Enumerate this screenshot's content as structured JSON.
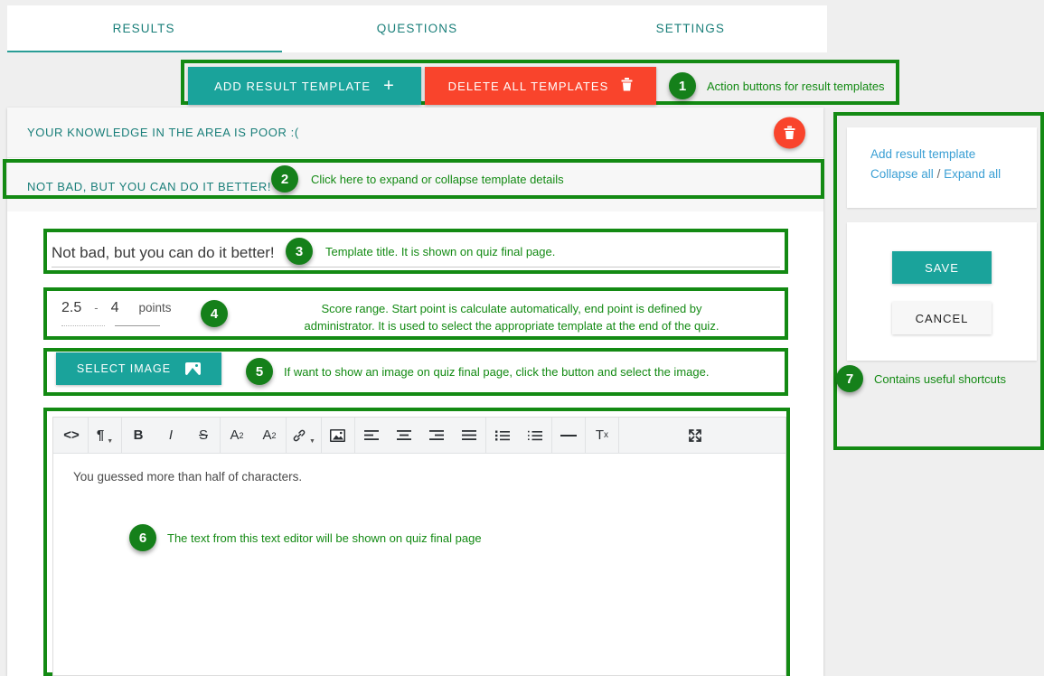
{
  "tabs": [
    {
      "label": "RESULTS",
      "active": true
    },
    {
      "label": "QUESTIONS",
      "active": false
    },
    {
      "label": "SETTINGS",
      "active": false
    }
  ],
  "toolbar": {
    "add_template_label": "ADD RESULT TEMPLATE",
    "add_template_icon": "plus-icon",
    "delete_all_label": "DELETE ALL TEMPLATES",
    "delete_all_icon": "trash-icon"
  },
  "annotations": {
    "a1": {
      "number": "1",
      "text": "Action buttons for result templates"
    },
    "a2": {
      "number": "2",
      "text": "Click here to expand or collapse template details"
    },
    "a3": {
      "number": "3",
      "text": "Template title. It is shown on quiz final page."
    },
    "a4": {
      "number": "4",
      "text": "Score range. Start point is calculate automatically, end point is defined by administrator. It is used to select the appropriate template at the end of the quiz."
    },
    "a5": {
      "number": "5",
      "text": "If want to show an image on quiz final page, click the button and select the image."
    },
    "a6": {
      "number": "6",
      "text": "The text from this text editor will be shown on quiz final page"
    },
    "a7": {
      "number": "7",
      "text": "Contains useful shortcuts"
    }
  },
  "templates": [
    {
      "header": "YOUR KNOWLEDGE IN THE AREA IS POOR :(",
      "delete_icon": "trash-icon"
    },
    {
      "header": "NOT BAD, BUT YOU CAN DO IT BETTER!"
    }
  ],
  "form": {
    "title_value": "Not bad, but you can do it better!",
    "score_start": "2.5",
    "score_dash": "-",
    "score_end": "4",
    "score_unit": "points",
    "select_image_label": "SELECT IMAGE",
    "select_image_icon": "image-icon"
  },
  "editor": {
    "content": "You guessed more than half of characters.",
    "tools": [
      {
        "name": "source-code-icon",
        "glyph": "<>"
      },
      {
        "name": "paragraph-format-icon",
        "glyph": "¶",
        "caret": true
      },
      {
        "name": "bold-icon",
        "glyph": "B"
      },
      {
        "name": "italic-icon",
        "glyph": "I"
      },
      {
        "name": "strikethrough-icon",
        "glyph": "S"
      },
      {
        "name": "superscript-icon",
        "glyph": "A"
      },
      {
        "name": "subscript-icon",
        "glyph": "A"
      },
      {
        "name": "link-icon",
        "glyph": "🔗",
        "caret": true
      },
      {
        "name": "insert-image-icon",
        "glyph": "▣"
      },
      {
        "name": "align-left-icon",
        "glyph": "≡"
      },
      {
        "name": "align-center-icon",
        "glyph": "≡"
      },
      {
        "name": "align-right-icon",
        "glyph": "≡"
      },
      {
        "name": "align-justify-icon",
        "glyph": "≡"
      },
      {
        "name": "unordered-list-icon",
        "glyph": "≣"
      },
      {
        "name": "ordered-list-icon",
        "glyph": "≣"
      },
      {
        "name": "horizontal-rule-icon",
        "glyph": "—"
      },
      {
        "name": "clear-formatting-icon",
        "glyph": "T"
      },
      {
        "name": "fullscreen-icon",
        "glyph": "⤢"
      }
    ]
  },
  "sidebar": {
    "shortcuts": {
      "add_result_template": "Add result template",
      "collapse_all": "Collapse all",
      "separator": "/",
      "expand_all": "Expand all"
    },
    "save_label": "SAVE",
    "cancel_label": "CANCEL"
  },
  "colors": {
    "teal": "#1aa39b",
    "red": "#f9442c",
    "annotation_green": "#138a13",
    "badge_green": "#15801a",
    "link_blue": "#3a9fd4",
    "tab_text": "#1a7f7a"
  }
}
